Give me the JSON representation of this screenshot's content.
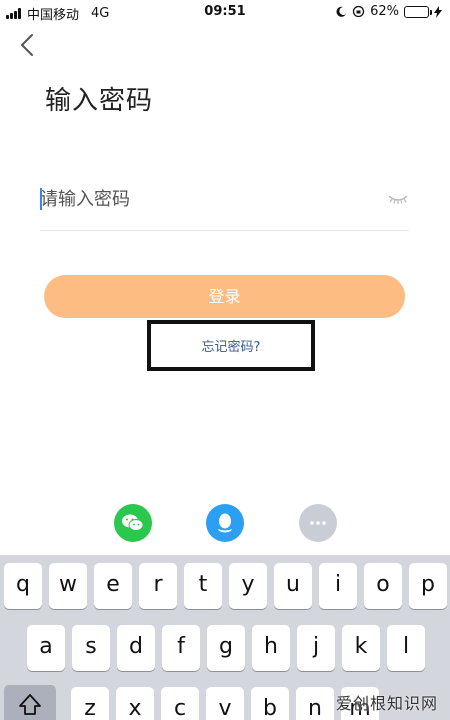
{
  "status_bar": {
    "carrier": "中国移动",
    "network": "4G",
    "time": "09:51",
    "battery_percent": "62%",
    "battery_level": 0.62
  },
  "header": {
    "back_icon": "chevron-left-icon",
    "title": "输入密码"
  },
  "form": {
    "password_placeholder": "请输入密码",
    "eye_icon": "eye-closed-icon",
    "login_label": "登录",
    "forgot_label": "忘记密码?"
  },
  "social": [
    {
      "icon": "wechat-icon",
      "color": "#2bc84e"
    },
    {
      "icon": "qq-icon",
      "color": "#2b9ff2"
    },
    {
      "icon": "more-icon",
      "color": "#c9ced6"
    }
  ],
  "keyboard": {
    "row1": [
      "q",
      "w",
      "e",
      "r",
      "t",
      "y",
      "u",
      "i",
      "o",
      "p"
    ],
    "row2": [
      "a",
      "s",
      "d",
      "f",
      "g",
      "h",
      "j",
      "k",
      "l"
    ],
    "row3": [
      "z",
      "x",
      "c",
      "v",
      "b",
      "n",
      "m"
    ]
  },
  "watermark": "爱创根知识网",
  "colors": {
    "login_button": "#fdbd82",
    "accent_link": "#3a5a8c"
  }
}
